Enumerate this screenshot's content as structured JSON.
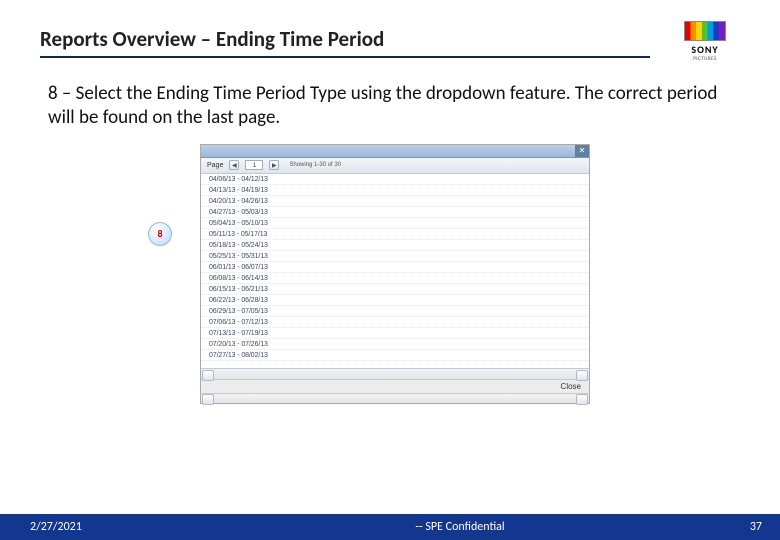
{
  "header": {
    "title": "Reports Overview – Ending Time Period",
    "logo": {
      "brand": "SONY",
      "division": "PICTURES"
    }
  },
  "body": {
    "step_text": "8 – Select the Ending Time Period Type using the dropdown feature. The correct period will be found on the last page."
  },
  "marker": {
    "label": "8"
  },
  "popup": {
    "close_glyph": "✕",
    "toolbar": {
      "page_label": "Page",
      "prev_glyph": "◀",
      "page_value": "1",
      "next_glyph": "▶",
      "showing": "Showing 1-30 of 30"
    },
    "rows": [
      "04/06/13 - 04/12/13",
      "04/13/13 - 04/19/13",
      "04/20/13 - 04/26/13",
      "04/27/13 - 05/03/13",
      "05/04/13 - 05/10/13",
      "05/11/13 - 05/17/13",
      "05/18/13 - 05/24/13",
      "05/25/13 - 05/31/13",
      "06/01/13 - 06/07/13",
      "06/08/13 - 06/14/13",
      "06/15/13 - 06/21/13",
      "06/22/13 - 06/28/13",
      "06/29/13 - 07/05/13",
      "07/06/13 - 07/12/13",
      "07/13/13 - 07/19/13",
      "07/20/13 - 07/26/13",
      "07/27/13 - 08/02/13"
    ],
    "footer": {
      "close_label": "Close"
    }
  },
  "footer": {
    "date": "2/27/2021",
    "confidential": "-- SPE Confidential",
    "page_number": "37"
  }
}
